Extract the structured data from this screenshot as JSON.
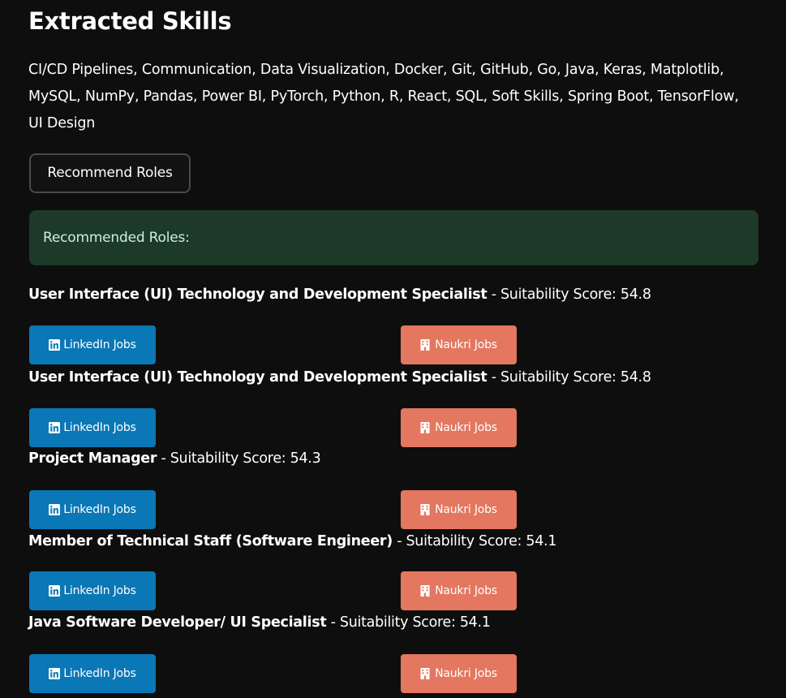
{
  "section": {
    "title": "Extracted Skills",
    "skills_text": "CI/CD Pipelines, Communication, Data Visualization, Docker, Git, GitHub, Go, Java, Keras, Matplotlib, MySQL, NumPy, Pandas, Power BI, PyTorch, Python, R, React, SQL, Soft Skills, Spring Boot, TensorFlow, UI Design"
  },
  "recommend_button_label": "Recommend Roles",
  "success_message": "Recommended Roles:",
  "roles": [
    {
      "title": "User Interface (UI) Technology and Development Specialist",
      "score_text": " - Suitability Score: 54.8",
      "linkedin_label": "LinkedIn Jobs",
      "naukri_label": "Naukri Jobs"
    },
    {
      "title": "User Interface (UI) Technology and Development Specialist",
      "score_text": " - Suitability Score: 54.8",
      "linkedin_label": "LinkedIn Jobs",
      "naukri_label": "Naukri Jobs"
    },
    {
      "title": "Project Manager",
      "score_text": " - Suitability Score: 54.3",
      "linkedin_label": "LinkedIn Jobs",
      "naukri_label": "Naukri Jobs"
    },
    {
      "title": "Member of Technical Staff (Software Engineer)",
      "score_text": " - Suitability Score: 54.1",
      "linkedin_label": "LinkedIn Jobs",
      "naukri_label": "Naukri Jobs"
    },
    {
      "title": "Java Software Developer/ UI Specialist",
      "score_text": " - Suitability Score: 54.1",
      "linkedin_label": "LinkedIn Jobs",
      "naukri_label": "Naukri Jobs"
    }
  ],
  "icons": {
    "linkedin": "linkedin-icon",
    "naukri": "building-icon"
  },
  "colors": {
    "background": "#0e0e0e",
    "linkedin_button": "#0a77b6",
    "naukri_button": "#e3775f",
    "success_box": "#1c3a27",
    "success_text": "#cfeedd"
  }
}
